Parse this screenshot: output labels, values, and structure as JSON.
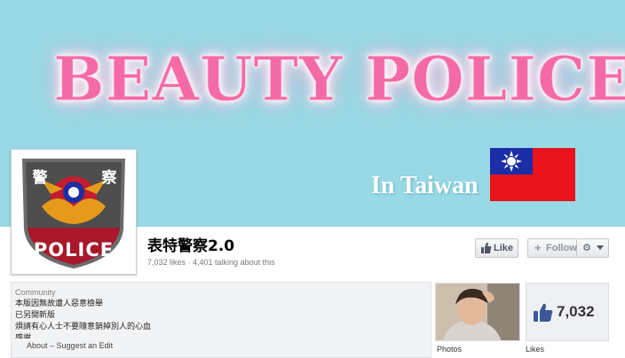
{
  "cover": {
    "title": "BEAUTY POLICE",
    "subtitle": "In Taiwan",
    "background_color": "#98d9e5",
    "title_color": "#f46aa6"
  },
  "profile": {
    "badge_char_left": "警",
    "badge_char_right": "察",
    "badge_text": "POLICE"
  },
  "page": {
    "name": "表特警察2.0",
    "stats": "7,032 likes · 4,401 talking about this"
  },
  "actions": {
    "like_label": "Like",
    "follow_label": "Follow",
    "like_icon": "thumbs-up-icon",
    "follow_icon": "plus-icon",
    "settings_icon": "gear-icon"
  },
  "about": {
    "category": "Community",
    "lines": [
      "本版因無故遭人惡意檢舉",
      "已另開新版",
      "煩請有心人士不要隨意銷掉別人的心血"
    ],
    "truncated_line": "感謝",
    "footer_about": "About",
    "footer_separator": " – ",
    "footer_suggest": "Suggest an Edit"
  },
  "tiles": {
    "photos_label": "Photos",
    "likes_label": "Likes",
    "likes_count": "7,032"
  },
  "colors": {
    "flag_red": "#e8141b",
    "flag_blue": "#1b2ea6",
    "facebook_blue": "#3b5998"
  }
}
